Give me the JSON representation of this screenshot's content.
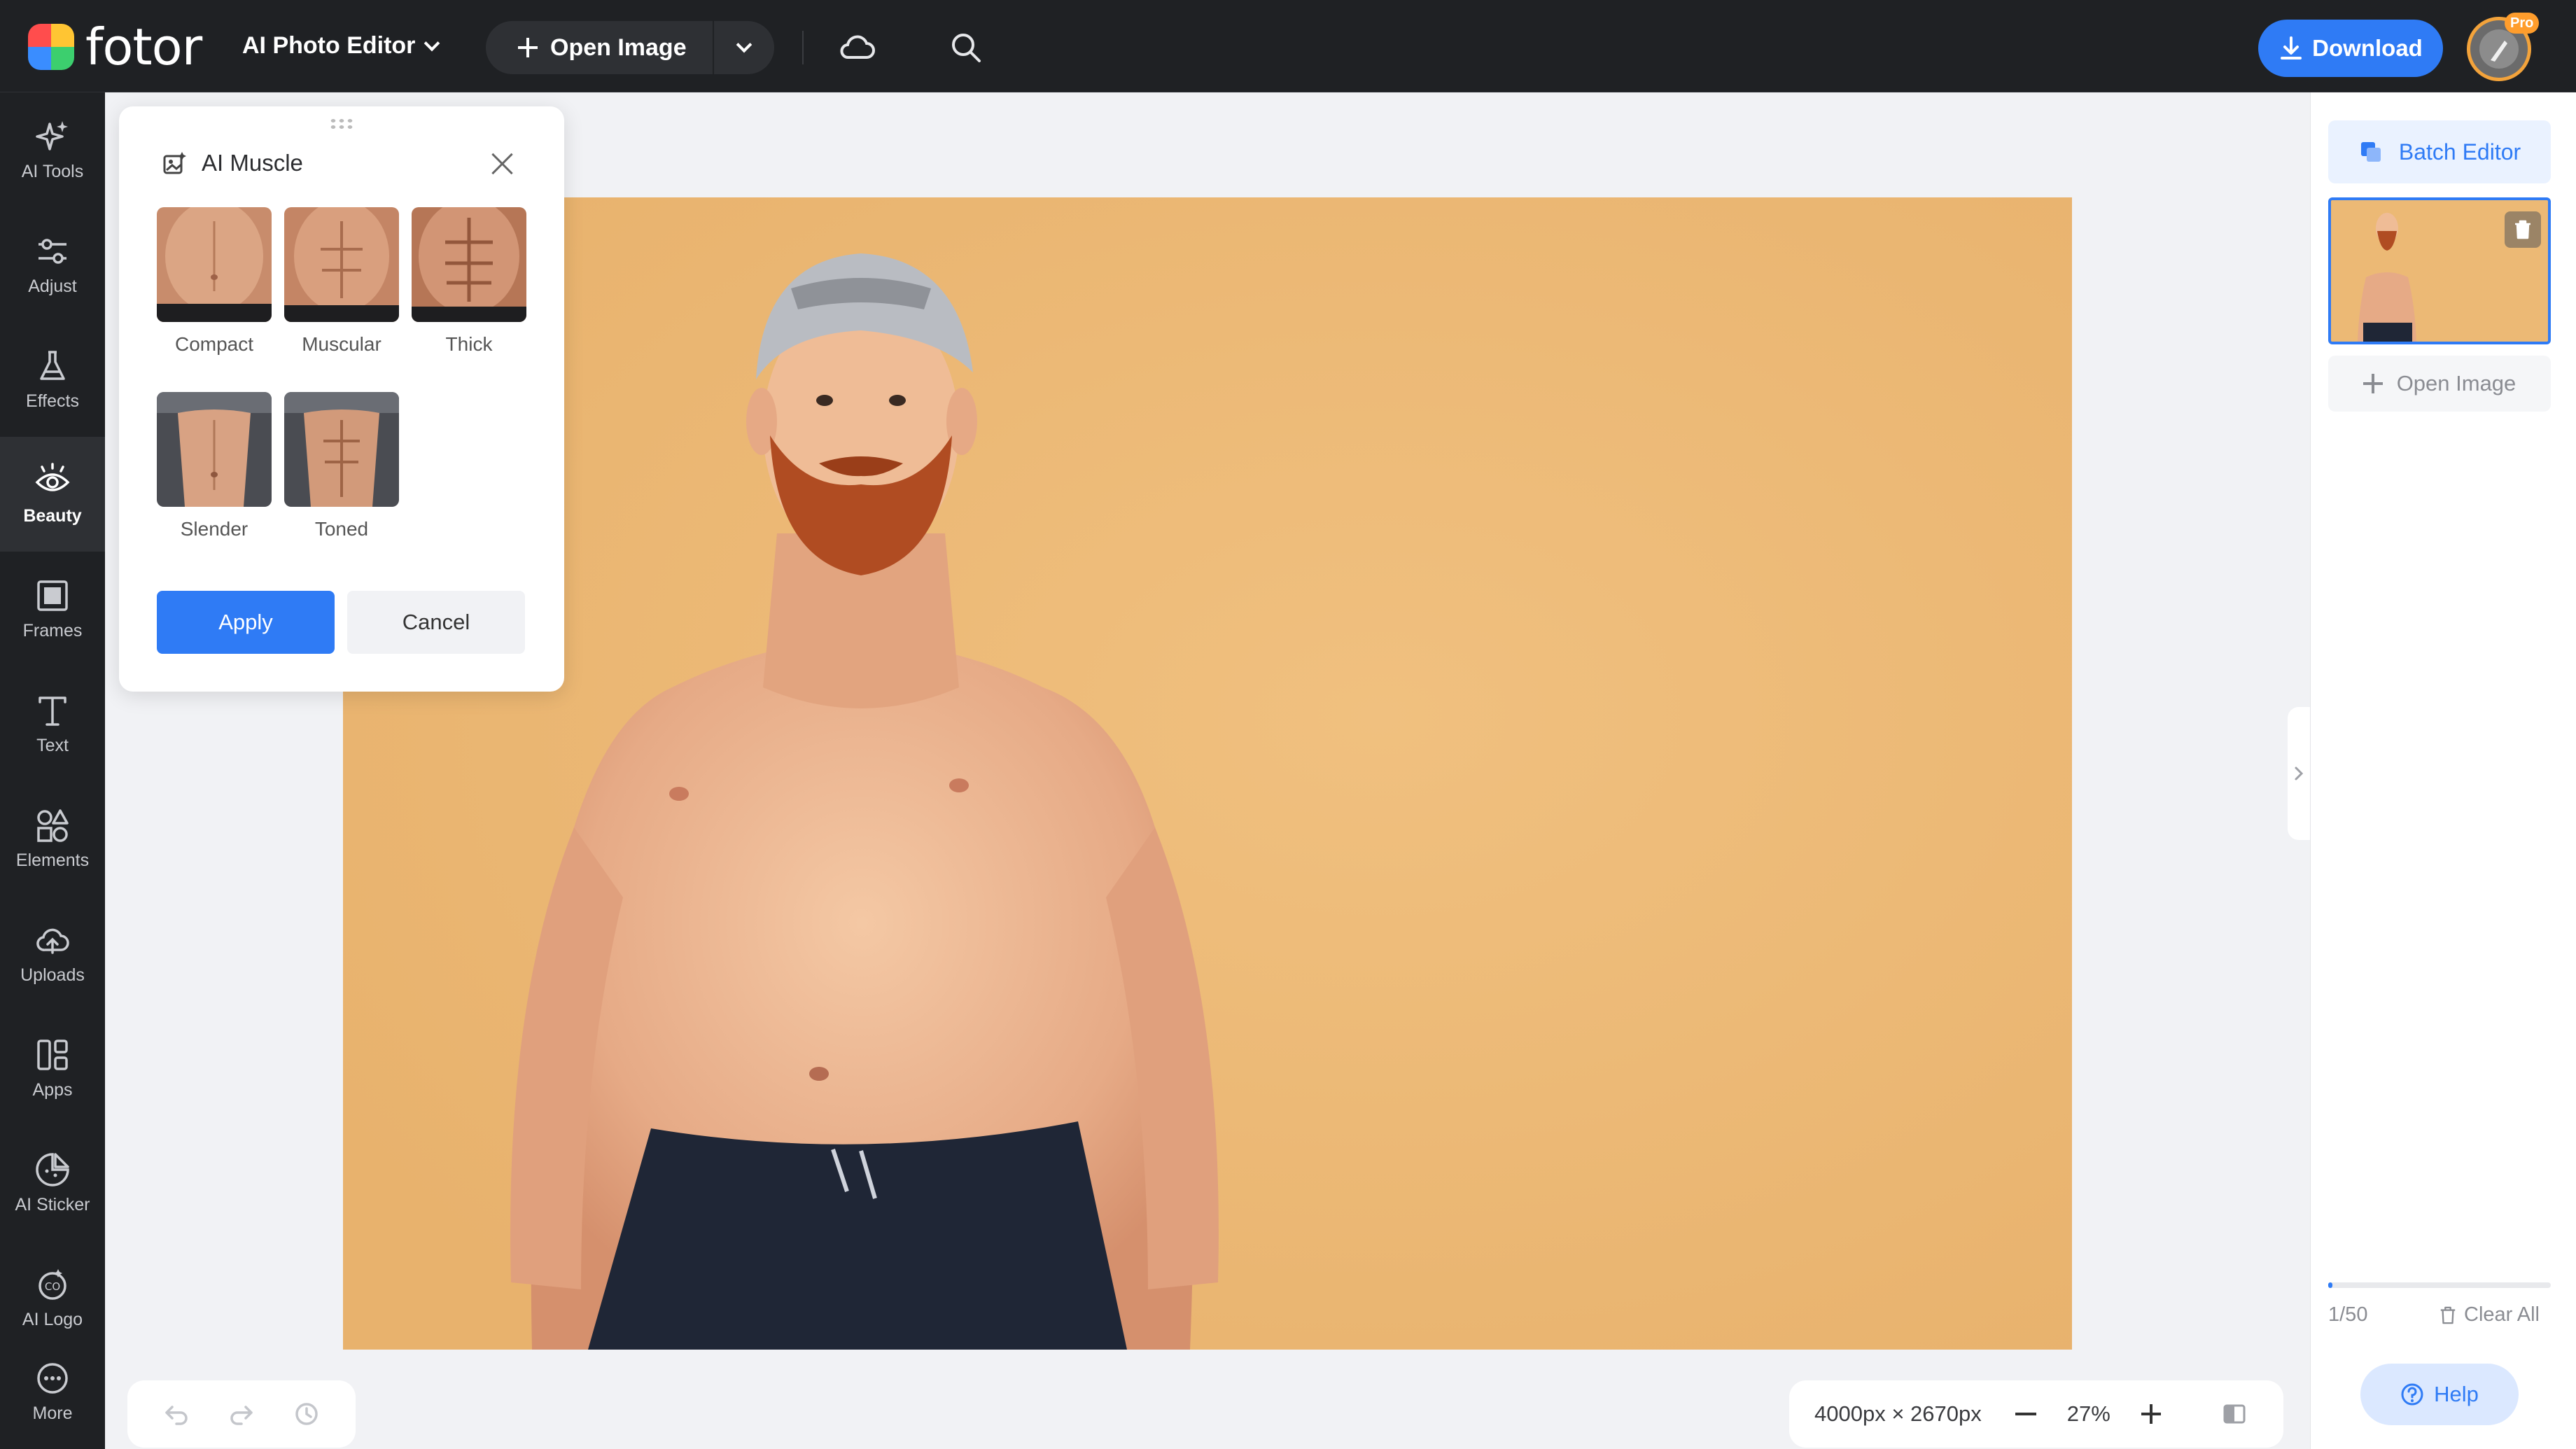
{
  "app": {
    "logo_text": "fotor",
    "editor_mode": "AI Photo Editor",
    "open_image_label": "Open Image",
    "download_label": "Download",
    "pro_badge": "Pro",
    "colors": {
      "accent": "#2f7bf5",
      "topbar": "#1f2124",
      "photo_bg": "#ecb975"
    }
  },
  "sidebar": {
    "items": [
      {
        "label": "AI Tools",
        "icon": "sparkle-icon"
      },
      {
        "label": "Adjust",
        "icon": "sliders-icon"
      },
      {
        "label": "Effects",
        "icon": "flask-icon"
      },
      {
        "label": "Beauty",
        "icon": "eye-icon",
        "active": true
      },
      {
        "label": "Frames",
        "icon": "frame-icon"
      },
      {
        "label": "Text",
        "icon": "text-icon"
      },
      {
        "label": "Elements",
        "icon": "shapes-icon"
      },
      {
        "label": "Uploads",
        "icon": "cloud-upload-icon"
      },
      {
        "label": "Apps",
        "icon": "apps-icon"
      },
      {
        "label": "AI Sticker",
        "icon": "sticker-icon"
      },
      {
        "label": "AI Logo",
        "icon": "logo-icon"
      },
      {
        "label": "More",
        "icon": "more-icon"
      }
    ]
  },
  "panel": {
    "title": "AI Muscle",
    "options": [
      {
        "label": "Compact"
      },
      {
        "label": "Muscular"
      },
      {
        "label": "Thick"
      },
      {
        "label": "Slender"
      },
      {
        "label": "Toned"
      }
    ],
    "apply_label": "Apply",
    "cancel_label": "Cancel"
  },
  "canvas": {
    "dimensions_text": "4000px × 2670px",
    "zoom_text": "27%"
  },
  "right_panel": {
    "batch_label": "Batch Editor",
    "open_image_label": "Open Image",
    "count_text": "1/50",
    "progress_fraction": 0.02,
    "clear_all_label": "Clear All",
    "help_label": "Help"
  }
}
